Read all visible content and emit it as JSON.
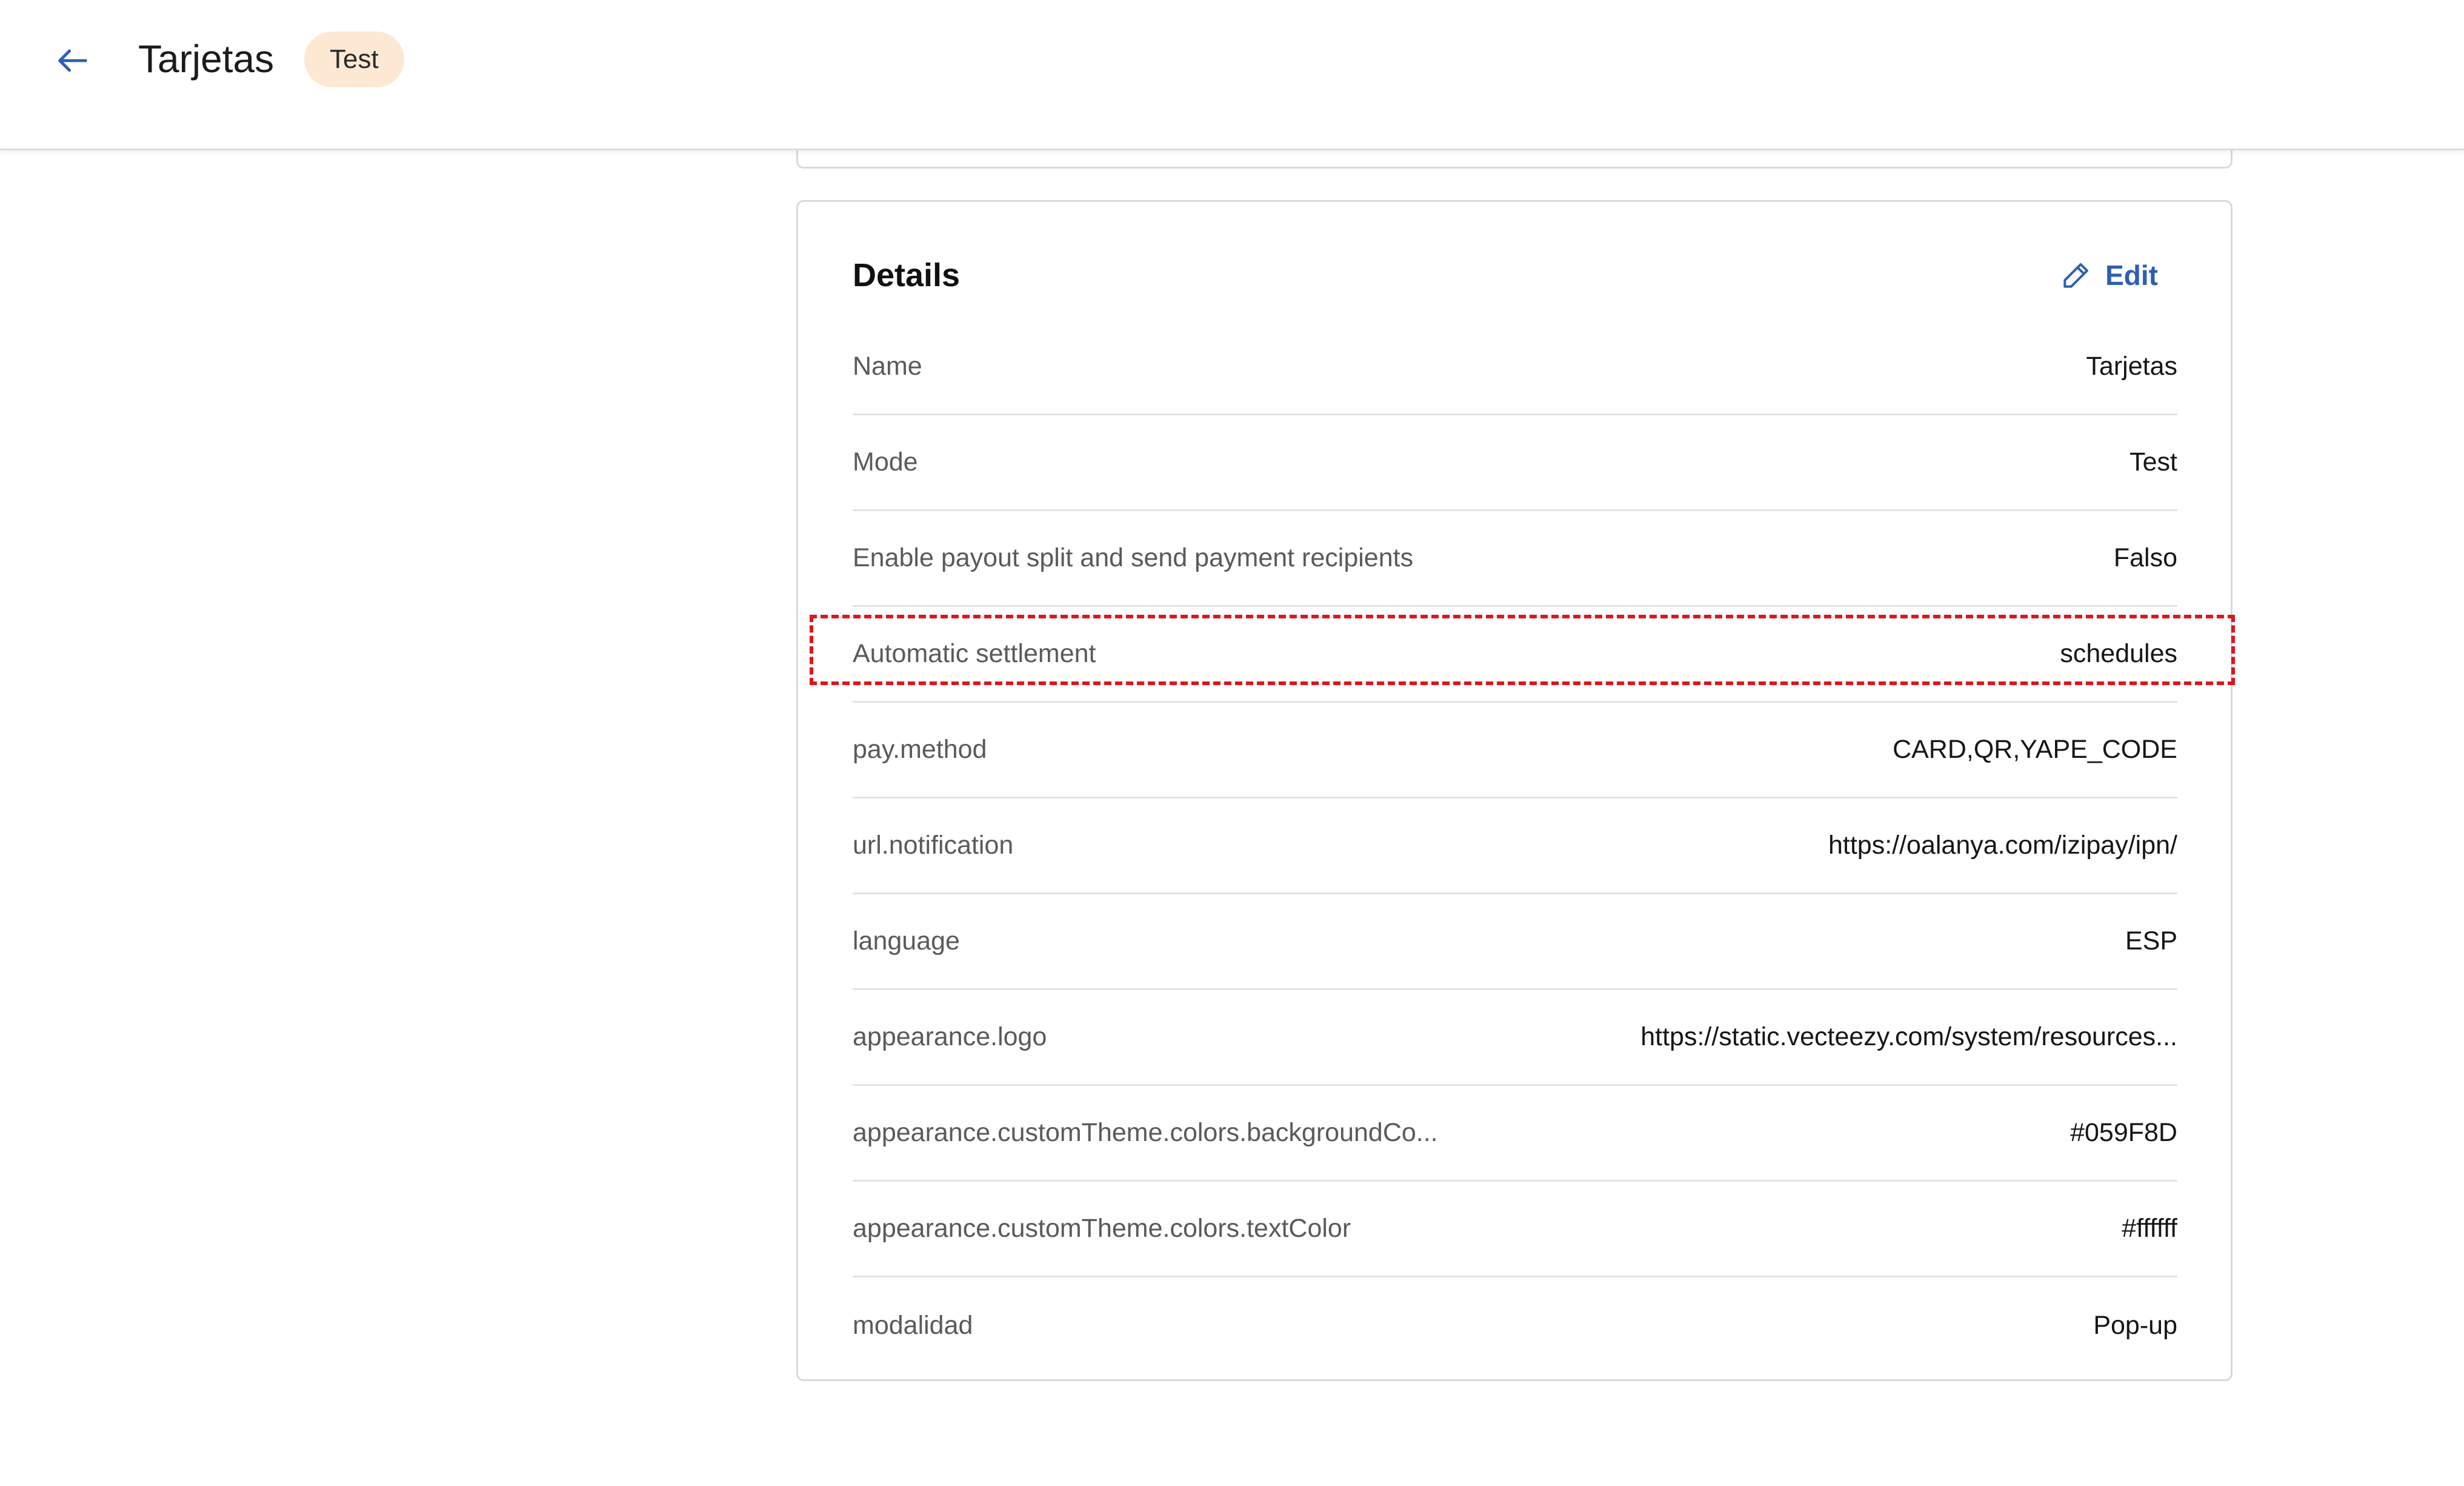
{
  "header": {
    "title": "Tarjetas",
    "mode_badge": "Test",
    "back_icon": "arrow-left-icon"
  },
  "details": {
    "title": "Details",
    "edit_label": "Edit",
    "edit_icon": "pencil-icon",
    "rows": [
      {
        "label": "Name",
        "value": "Tarjetas"
      },
      {
        "label": "Mode",
        "value": "Test"
      },
      {
        "label": "Enable payout split and send payment recipients",
        "value": "Falso"
      },
      {
        "label": "Automatic settlement",
        "value": "schedules"
      },
      {
        "label": "pay.method",
        "value": "CARD,QR,YAPE_CODE"
      },
      {
        "label": "url.notification",
        "value": "https://oalanya.com/izipay/ipn/"
      },
      {
        "label": "language",
        "value": "ESP"
      },
      {
        "label": "appearance.logo",
        "value": "https://static.vecteezy.com/system/resources..."
      },
      {
        "label": "appearance.customTheme.colors.backgroundCo...",
        "value": "#059F8D"
      },
      {
        "label": "appearance.customTheme.colors.textColor",
        "value": "#ffffff"
      },
      {
        "label": "modalidad",
        "value": "Pop-up"
      }
    ]
  },
  "colors": {
    "accent": "#2d5fb3",
    "badge_bg": "#fde8d4",
    "highlight": "#e0141c"
  }
}
